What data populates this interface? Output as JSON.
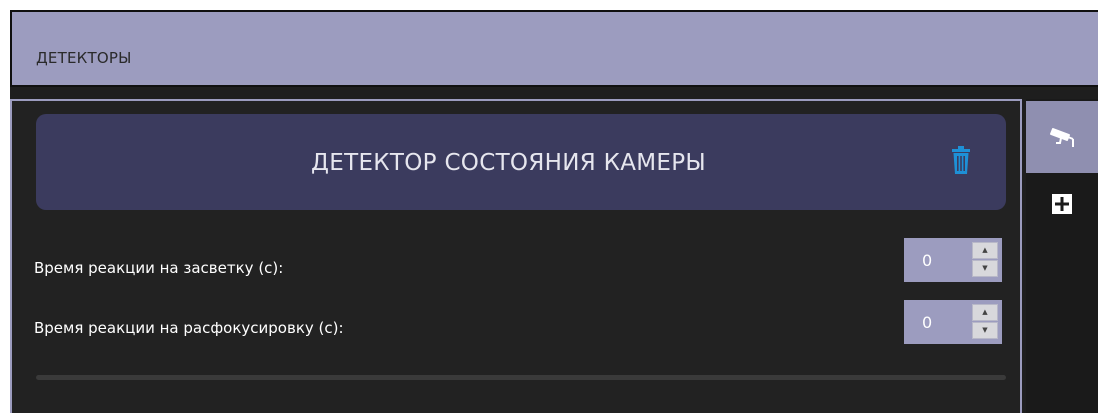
{
  "header": {
    "title": "ДЕТЕКТОРЫ"
  },
  "side_tabs": {
    "camera_icon": "camera-icon",
    "add_icon": "plus-icon"
  },
  "detector": {
    "title": "ДЕТЕКТОР СОСТОЯНИЯ КАМЕРЫ",
    "delete_icon": "trash-icon"
  },
  "fields": [
    {
      "label": "Время реакции на засветку (с):",
      "value": "0"
    },
    {
      "label": "Время реакции на расфокусировку (с):",
      "value": "0"
    }
  ],
  "colors": {
    "header_bg": "#9c9cbf",
    "card_bg": "#3b3b5e",
    "panel_bg": "#222222",
    "trash_accent": "#1e90d6"
  }
}
